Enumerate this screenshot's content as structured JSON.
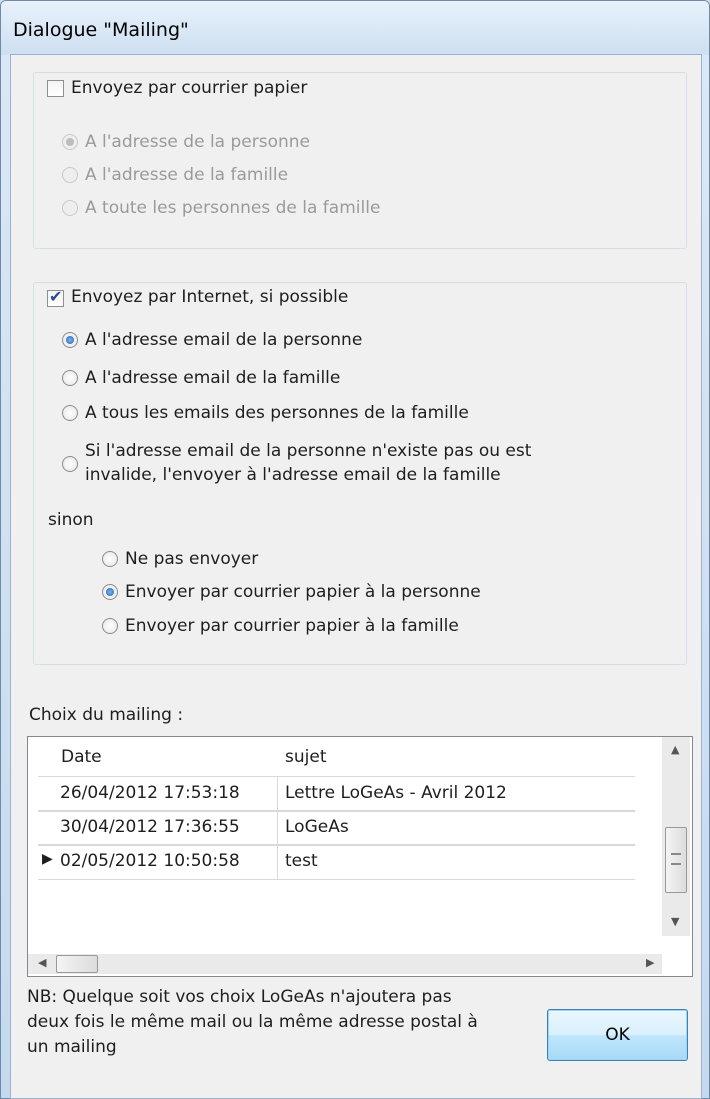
{
  "window": {
    "title": "Dialogue \"Mailing\""
  },
  "paper": {
    "checkbox_label": "Envoyez par courrier papier",
    "checked": false,
    "options": [
      "A l'adresse de la personne",
      "A l'adresse de la famille",
      "A toute les personnes de la famille"
    ],
    "selected_index": 0
  },
  "internet": {
    "checkbox_label": "Envoyez par Internet, si possible",
    "checked": true,
    "options": [
      "A l'adresse email de la personne",
      "A l'adresse email de la famille",
      "A tous les emails des personnes de la famille"
    ],
    "option4_line1": "Si l'adresse email de la personne n'existe pas ou est",
    "option4_line2": "invalide, l'envoyer à l'adresse email de la famille",
    "selected_index": 0,
    "otherwise_label": "sinon",
    "fallback_options": [
      "Ne pas envoyer",
      "Envoyer par courrier papier à la personne",
      "Envoyer par courrier papier à la famille"
    ],
    "fallback_selected_index": 1
  },
  "mailing": {
    "label": "Choix du mailing :",
    "columns": [
      "Date",
      "sujet"
    ],
    "rows": [
      {
        "date": "26/04/2012 17:53:18",
        "subject": "Lettre LoGeAs - Avril 2012",
        "current": false
      },
      {
        "date": "30/04/2012 17:36:55",
        "subject": "LoGeAs",
        "current": false
      },
      {
        "date": "02/05/2012 10:50:58",
        "subject": "test",
        "current": true
      }
    ]
  },
  "note": {
    "line1": "NB: Quelque soit vos choix LoGeAs n'ajoutera pas",
    "line2": "deux fois le même mail ou la même adresse postal à",
    "line3": "un mailing"
  },
  "ok_label": "OK",
  "colors": {
    "accent": "#1d5fb8",
    "disabled_text": "#9a9a9a"
  }
}
